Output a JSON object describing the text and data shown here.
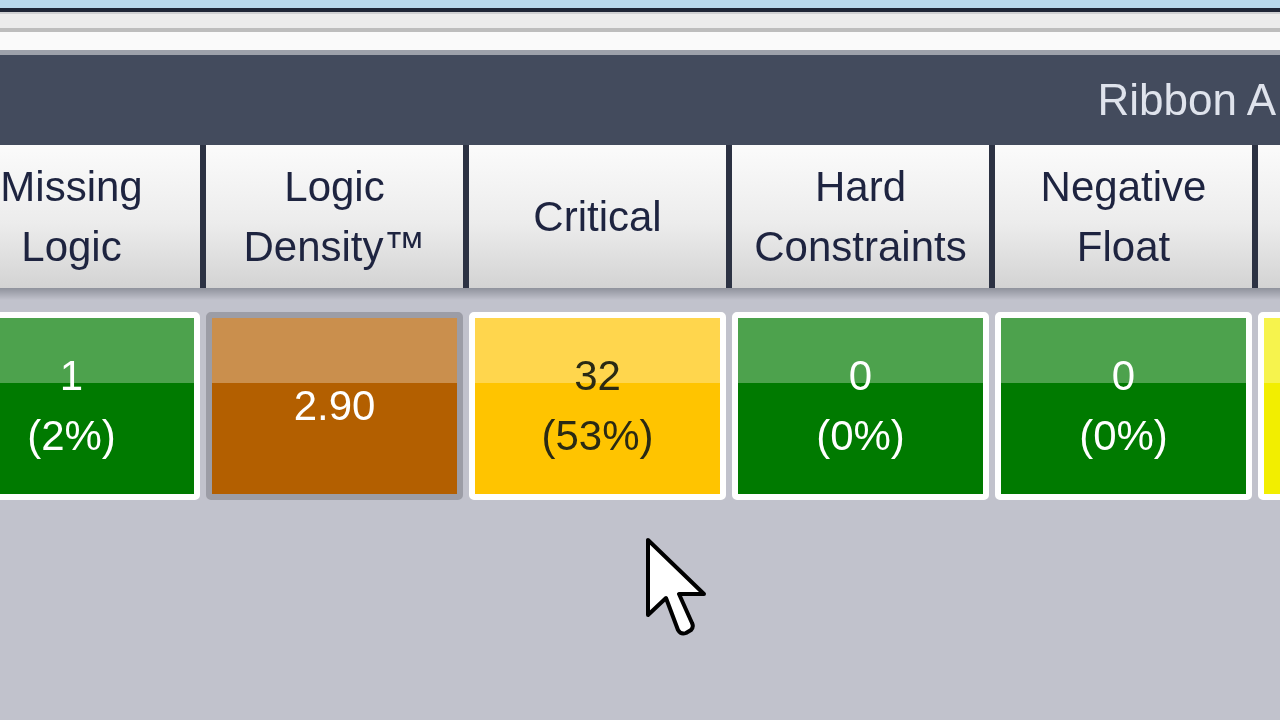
{
  "ribbon": {
    "title": "Ribbon A"
  },
  "metrics": [
    {
      "header": "Missing\nLogic",
      "value": "1",
      "percent": "(2%)",
      "color": "#007a00",
      "selected": false
    },
    {
      "header": "Logic\nDensity™",
      "value": "2.90",
      "color": "#b35f00",
      "selected": true
    },
    {
      "header": "Critical",
      "value": "32",
      "percent": "(53%)",
      "color": "#ffc400",
      "selected": false
    },
    {
      "header": "Hard\nConstraints",
      "value": "0",
      "percent": "(0%)",
      "color": "#007a00",
      "selected": false
    },
    {
      "header": "Negative\nFloat",
      "value": "0",
      "percent": "(0%)",
      "color": "#007a00",
      "selected": false
    },
    {
      "color": "#f2ee00",
      "selected": false
    }
  ]
}
